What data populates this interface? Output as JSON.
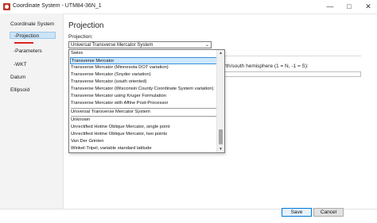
{
  "window": {
    "title": "Coordinate System - UTM84-36N_1"
  },
  "sidebar": {
    "items": [
      {
        "label": "Coordinate System"
      },
      {
        "label": "-Projection"
      },
      {
        "label": "-Parameters"
      },
      {
        "label": "-WKT"
      },
      {
        "label": "Datum"
      },
      {
        "label": "Ellipsoid"
      }
    ]
  },
  "main": {
    "heading": "Projection",
    "projection_label": "Projection:",
    "selected_projection": "Universal Transverse Mercator System",
    "background_text": "rth/south hemisphere (1 = N, -1 = S):"
  },
  "dropdown": {
    "options": [
      "Swiss",
      "Transverse Mercator",
      "Transverse Mercator (Minnesota DOT variation)",
      "Transverse Mercator (Snyder variation)",
      "Transverse Mercator (south oriented)",
      "Transverse Mercator (Wisconsin County Coordinate System variation)",
      "Transverse Mercator using Kruger Formulation",
      "Transverse Mercator with Affine Post-Processor",
      "Universal Transverse Mercator System",
      "Unknown",
      "Unrectified Hotine Oblique Mercator, single point",
      "Unrectified Hotine Oblique Mercator, two points",
      "Van Der Grinten",
      "Winkel-Tripel, variable standard latitude"
    ],
    "highlighted": "Transverse Mercator"
  },
  "footer": {
    "save_label": "Save",
    "cancel_label": "Cancel"
  },
  "icons": {
    "app": "app-icon",
    "minimize": "minimize-icon",
    "maximize": "maximize-icon",
    "close": "close-icon",
    "combo_arrow": "chevron-down-icon"
  }
}
